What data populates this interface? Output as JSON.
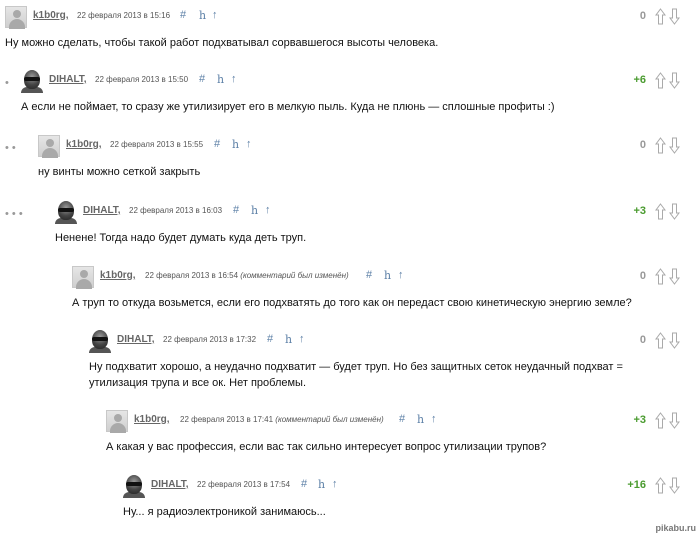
{
  "comments": [
    {
      "username": "k1b0rg,",
      "date": "22 февраля 2013 в 15:16",
      "edited": "",
      "hash": "#",
      "h": "h",
      "up": "↑",
      "score": "0",
      "avatar": "default-avatar",
      "text": "Ну можно сделать, чтобы такой работ подхватывал сорвавшегося высоты человека.",
      "indent_dots": ""
    },
    {
      "username": "DIHALT,",
      "date": "22 февраля 2013 в 15:50",
      "edited": "",
      "hash": "#",
      "h": "h",
      "up": "↑",
      "score": "+6",
      "avatar": "dihalt-avatar",
      "text": "А если не поймает, то сразу же утилизирует его в мелкую пыль. Куда не плюнь — сплошные профиты :)",
      "indent_dots": "•"
    },
    {
      "username": "k1b0rg,",
      "date": "22 февраля 2013 в 15:55",
      "edited": "",
      "hash": "#",
      "h": "h",
      "up": "↑",
      "score": "0",
      "avatar": "default-avatar",
      "text": "ну винты можно сеткой закрыть",
      "indent_dots": "• •"
    },
    {
      "username": "DIHALT,",
      "date": "22 февраля 2013 в 16:03",
      "edited": "",
      "hash": "#",
      "h": "h",
      "up": "↑",
      "score": "+3",
      "avatar": "dihalt-avatar",
      "text": "Ненене! Тогда надо будет думать куда деть труп.",
      "indent_dots": "• • •"
    },
    {
      "username": "k1b0rg,",
      "date": "22 февраля 2013 в 16:54",
      "edited": "(комментарий был изменён)",
      "hash": "#",
      "h": "h",
      "up": "↑",
      "score": "0",
      "avatar": "default-avatar",
      "text": "А труп то откуда возьмется, если его подхватять до того как он передаст свою кинетическую энергию земле?",
      "indent_dots": ""
    },
    {
      "username": "DIHALT,",
      "date": "22 февраля 2013 в 17:32",
      "edited": "",
      "hash": "#",
      "h": "h",
      "up": "↑",
      "score": "0",
      "avatar": "dihalt-avatar",
      "text": "Ну подхватит хорошо, а неудачно подхватит — будет труп. Но без защитных сеток неудачный подхват = утилизация трупа и все ок. Нет проблемы.",
      "indent_dots": ""
    },
    {
      "username": "k1b0rg,",
      "date": "22 февраля 2013 в 17:41",
      "edited": "(комментарий был изменён)",
      "hash": "#",
      "h": "h",
      "up": "↑",
      "score": "+3",
      "avatar": "default-avatar",
      "text": "А какая у вас профессия, если вас так сильно интересует вопрос утилизации трупов?",
      "indent_dots": ""
    },
    {
      "username": "DIHALT,",
      "date": "22 февраля 2013 в 17:54",
      "edited": "",
      "hash": "#",
      "h": "h",
      "up": "↑",
      "score": "+16",
      "avatar": "dihalt-avatar",
      "text": "Ну... я радиоэлектроникой занимаюсь...",
      "indent_dots": ""
    }
  ],
  "watermark": "pikabu.ru",
  "colors": {
    "score_positive": "#4a9b2f",
    "score_zero": "#999999",
    "link": "#5b7fa6"
  }
}
